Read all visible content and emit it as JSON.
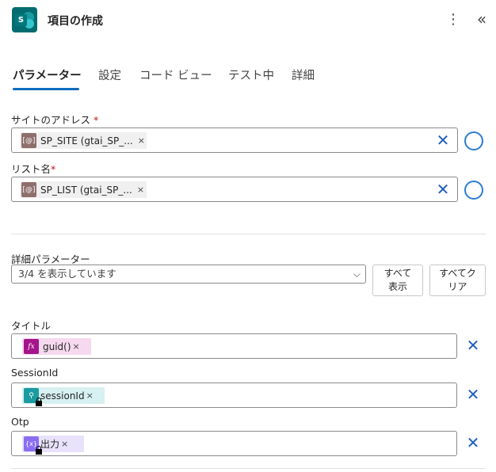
{
  "header": {
    "app_icon_letter": "S",
    "title": "項目の作成",
    "more_glyph": "⋮",
    "collapse_glyph": "«"
  },
  "tabs": [
    {
      "label": "パラメーター",
      "active": true
    },
    {
      "label": "設定"
    },
    {
      "label": "コード ビュー"
    },
    {
      "label": "テスト中"
    },
    {
      "label": "詳細"
    }
  ],
  "site_address": {
    "label": "サイトのアドレス",
    "required_mark": "*",
    "token_icon": "[@]",
    "token_text": "SP_SITE (gtai_SP_...",
    "token_remove": "×",
    "clear_glyph": "✕"
  },
  "list_name": {
    "label": "リスト名",
    "required_mark": "*",
    "token_icon": "[@]",
    "token_text": "SP_LIST (gtai_SP_...",
    "token_remove": "×",
    "clear_glyph": "✕"
  },
  "advanced": {
    "label": "詳細パラメーター",
    "select_value": "3/4 を表示しています",
    "chevron": "⌵",
    "show_all_line1": "すべて",
    "show_all_line2": "表示",
    "clear_all_line1": "すべてク",
    "clear_all_line2": "リア"
  },
  "fields": {
    "title": {
      "label": "タイトル",
      "token_icon": "fx",
      "token_text": "guid()",
      "token_remove": "×",
      "clear_glyph": "✕"
    },
    "session": {
      "label": "SessionId",
      "token_icon": "⚲",
      "token_text": "sessionId",
      "token_remove": "×",
      "clear_glyph": "✕"
    },
    "otp": {
      "label": "Otp",
      "token_icon": "{x}",
      "token_text": "出力",
      "token_remove": "×",
      "clear_glyph": "✕"
    }
  },
  "colors": {
    "accent": "#0f6cbd",
    "sharepoint": "#036c70",
    "required": "#c50f1f"
  }
}
